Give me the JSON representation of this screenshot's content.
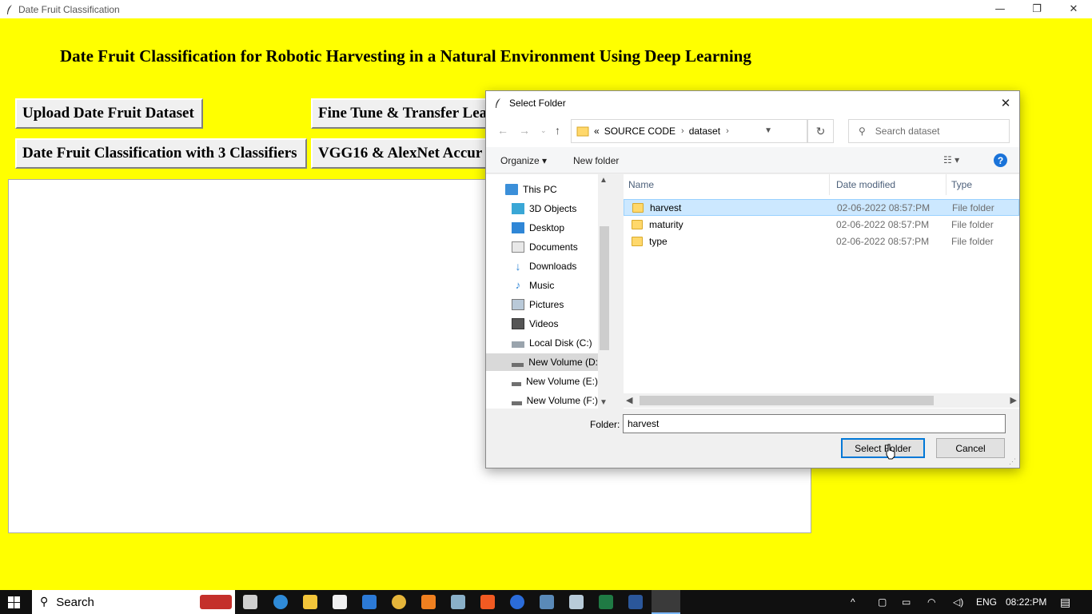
{
  "window": {
    "title": "Date Fruit Classification",
    "min": "—",
    "max": "❐",
    "close": "✕"
  },
  "app": {
    "heading": "Date Fruit Classification for Robotic Harvesting in a Natural Environment Using Deep Learning",
    "buttons": {
      "upload": "Upload Date Fruit Dataset",
      "finetune": "Fine Tune & Transfer Lea",
      "classify": "Date Fruit Classification with 3 Classifiers",
      "vgg": "VGG16 & AlexNet Accur"
    }
  },
  "dialog": {
    "title": "Select Folder",
    "close": "✕",
    "breadcrumb": {
      "prefix": "«",
      "parts": [
        "SOURCE CODE",
        "dataset"
      ]
    },
    "search_placeholder": "Search dataset",
    "toolbar": {
      "organize": "Organize ▾",
      "new_folder": "New folder",
      "help": "?"
    },
    "nav": [
      {
        "label": "This PC",
        "icon": "pc-icon"
      },
      {
        "label": "3D Objects",
        "icon": "cube-icon"
      },
      {
        "label": "Desktop",
        "icon": "desktop-icon"
      },
      {
        "label": "Documents",
        "icon": "documents-icon"
      },
      {
        "label": "Downloads",
        "icon": "download-icon"
      },
      {
        "label": "Music",
        "icon": "music-icon"
      },
      {
        "label": "Pictures",
        "icon": "pictures-icon"
      },
      {
        "label": "Videos",
        "icon": "videos-icon"
      },
      {
        "label": "Local Disk (C:)",
        "icon": "disk-icon"
      },
      {
        "label": "New Volume (D:",
        "icon": "drive-icon",
        "selected": true
      },
      {
        "label": "New Volume (E:)",
        "icon": "drive-icon"
      },
      {
        "label": "New Volume (F:)",
        "icon": "drive-icon"
      }
    ],
    "columns": {
      "name": "Name",
      "date": "Date modified",
      "type": "Type"
    },
    "files": [
      {
        "name": "harvest",
        "date": "02-06-2022 08:57:PM",
        "type": "File folder",
        "selected": true
      },
      {
        "name": "maturity",
        "date": "02-06-2022 08:57:PM",
        "type": "File folder"
      },
      {
        "name": "type",
        "date": "02-06-2022 08:57:PM",
        "type": "File folder"
      }
    ],
    "folder_label": "Folder:",
    "folder_value": "harvest",
    "select_button": "Select Folder",
    "cancel_button": "Cancel"
  },
  "taskbar": {
    "search_label": "Search",
    "language": "ENG",
    "time": "08:22:PM"
  }
}
